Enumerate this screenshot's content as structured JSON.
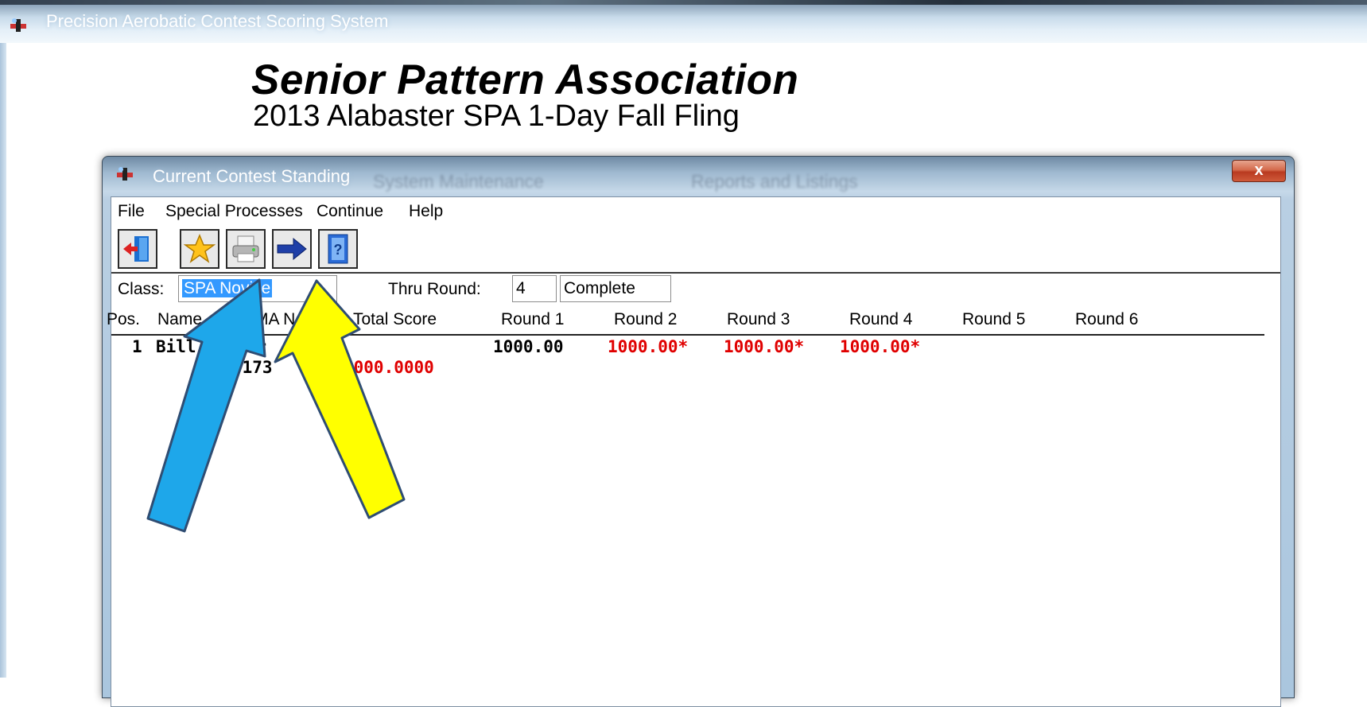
{
  "app": {
    "title": "Precision Aerobatic Contest Scoring System"
  },
  "heading": {
    "org": "Senior Pattern Association",
    "event": "2013 Alabaster SPA 1-Day Fall Fling"
  },
  "window": {
    "title": "Current Contest Standing",
    "background_tabs": [
      "System Maintenance",
      "Reports and Listings"
    ],
    "close_label": "x"
  },
  "menu": {
    "items": [
      "File",
      "Special Processes",
      "Continue",
      "Help"
    ]
  },
  "toolbar": {
    "buttons": [
      {
        "icon": "exit-door-icon"
      },
      {
        "icon": "star-icon"
      },
      {
        "icon": "printer-icon"
      },
      {
        "icon": "arrow-right-icon"
      },
      {
        "icon": "help-book-icon"
      }
    ]
  },
  "filters": {
    "class_label": "Class:",
    "class_value": "SPA Novice",
    "thru_round_label": "Thru Round:",
    "thru_round_value": "4",
    "status_value": "Complete"
  },
  "table": {
    "headers": [
      "Pos.",
      "Name",
      "AMA No.",
      "Total Score",
      "Round 1",
      "Round 2",
      "Round 3",
      "Round 4",
      "Round 5",
      "Round 6"
    ],
    "rows": [
      {
        "pos": "1",
        "name": "Bill Parker",
        "ama": "9173",
        "total": "3000.0000",
        "round1": "1000.00",
        "round2": "1000.00*",
        "round3": "1000.00*",
        "round4": "1000.00*"
      }
    ]
  },
  "annotation_colors": {
    "blue_arrow": "#1ea7ea",
    "yellow_arrow": "#ffff00",
    "arrow_outline": "#2f4d73"
  }
}
